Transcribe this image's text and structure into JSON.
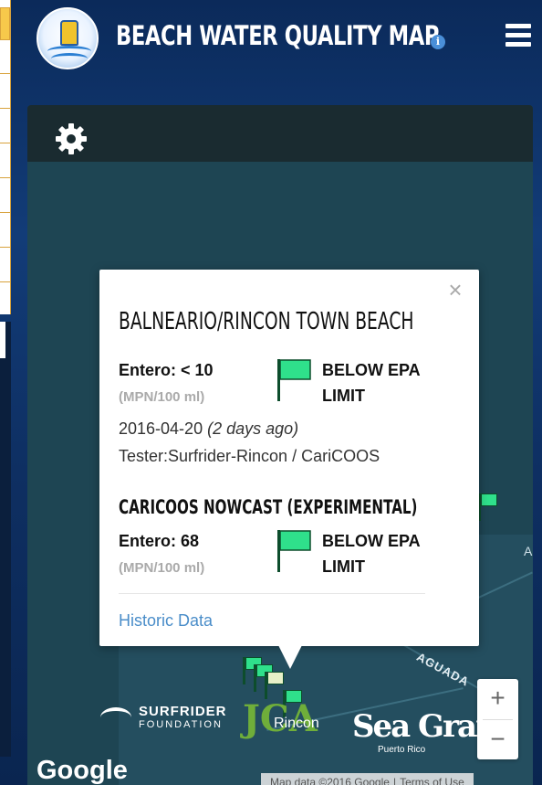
{
  "header": {
    "title": "BEACH WATER QUALITY MAP",
    "info_glyph": "i"
  },
  "icons": {
    "logo": "buoy-logo-icon",
    "info": "info-icon",
    "menu": "hamburger-menu-icon",
    "settings": "gear-icon",
    "close": "close-icon",
    "flag": "flag-icon"
  },
  "popup": {
    "close_glyph": "×",
    "beach_name": "BALNEARIO/RINCON TOWN BEACH",
    "sample": {
      "entero_label": "Entero: < 10",
      "units": "(MPN/100 ml)",
      "status_line1": "BELOW EPA",
      "status_line2": "LIMIT",
      "date": "2016-04-20",
      "relative_date": "(2 days ago)",
      "tester": "Tester:Surfrider-Rincon / CariCOOS"
    },
    "nowcast": {
      "title": "CARICOOS NOWCAST (EXPERIMENTAL)",
      "entero_label": "Entero: 68",
      "units": "(MPN/100 ml)",
      "status_line1": "BELOW EPA",
      "status_line2": "LIMIT"
    },
    "historic_link": "Historic Data"
  },
  "map": {
    "label_a": "A",
    "label_aguada": "AGUADA",
    "label_rincon": "Rincon",
    "logos": {
      "surfrider_line1": "SURFRIDER",
      "surfrider_line2": "FOUNDATION",
      "jca": "JCA",
      "seagrant_line1": "Sea Grant",
      "seagrant_line2": "Puerto Rico"
    },
    "zoom_in": "+",
    "zoom_out": "−",
    "google": "Google",
    "attribution_data": "Map data ©2016 Google",
    "attribution_terms": "Terms of Use"
  },
  "colors": {
    "flag_green": "#2fe08b",
    "link_blue": "#4a8dc9",
    "map_water": "#1e4553"
  }
}
